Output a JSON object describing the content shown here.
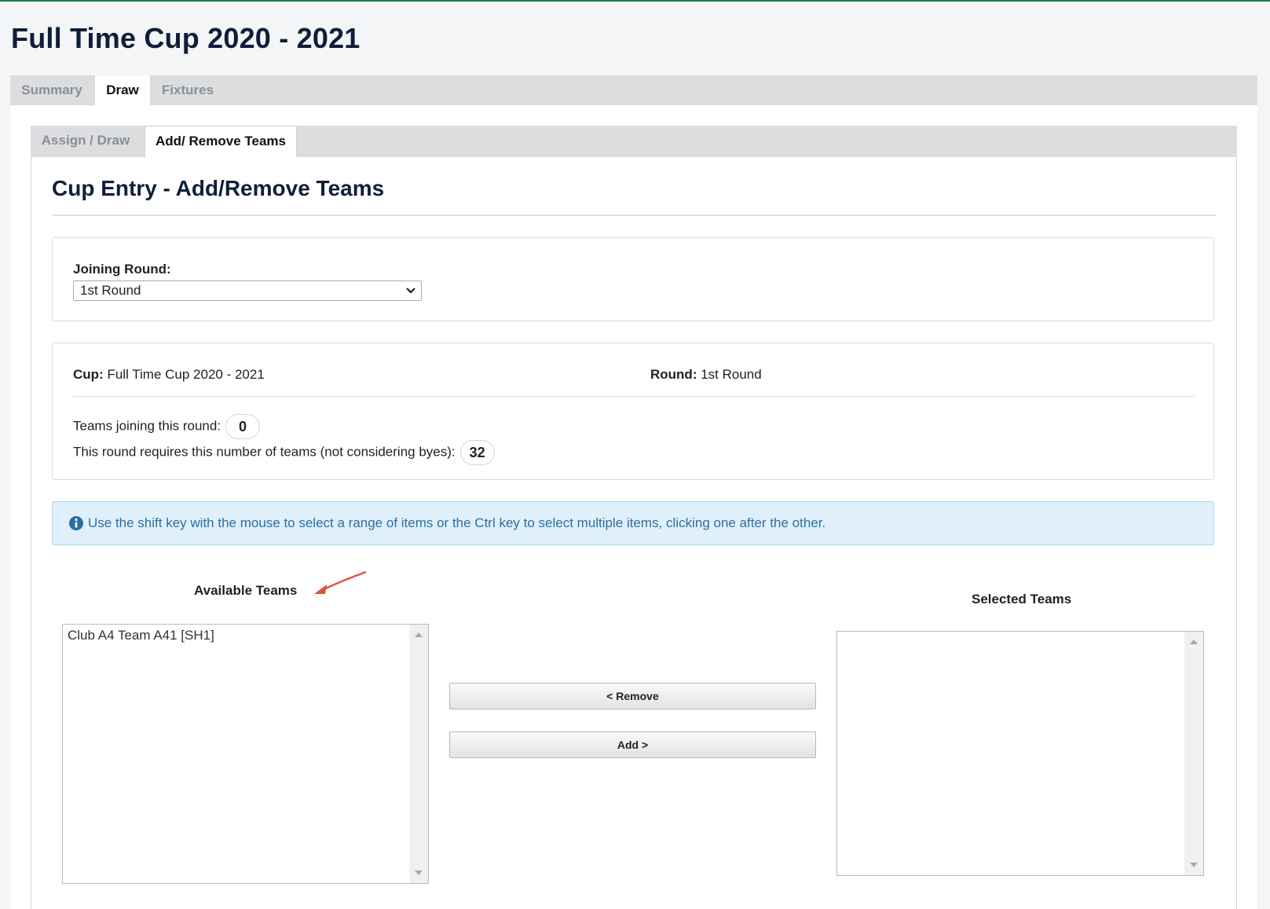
{
  "page": {
    "title": "Full Time Cup 2020 - 2021"
  },
  "main_tabs": [
    {
      "label": "Summary"
    },
    {
      "label": "Draw",
      "active": true
    },
    {
      "label": "Fixtures"
    }
  ],
  "sub_tabs": [
    {
      "label": "Assign / Draw"
    },
    {
      "label": "Add/ Remove Teams",
      "active": true
    }
  ],
  "section": {
    "title": "Cup Entry - Add/Remove Teams"
  },
  "joining_round": {
    "label": "Joining Round:",
    "selected": "1st Round"
  },
  "cup_info": {
    "cup_label": "Cup:",
    "cup_value": "Full Time Cup 2020 - 2021",
    "round_label": "Round:",
    "round_value": "1st Round",
    "teams_joining_label": "Teams joining this round:",
    "teams_joining_count": "0",
    "required_label": "This round requires this number of teams (not considering byes):",
    "required_count": "32"
  },
  "alert": {
    "icon": "info-icon",
    "text": "Use the shift key with the mouse to select a range of items or the Ctrl key to select multiple items, clicking one after the other."
  },
  "available": {
    "heading": "Available Teams",
    "items": [
      "Club A4 Team A41 [SH1]"
    ]
  },
  "selected": {
    "heading": "Selected Teams",
    "items": []
  },
  "buttons": {
    "remove": "< Remove",
    "add": "Add >"
  },
  "colors": {
    "accent_green": "#1e7e4a",
    "title_navy": "#0f1f3a",
    "alert_bg": "#dff0fa",
    "alert_text": "#2a6fa3",
    "annotation_arrow": "#e0513a"
  }
}
